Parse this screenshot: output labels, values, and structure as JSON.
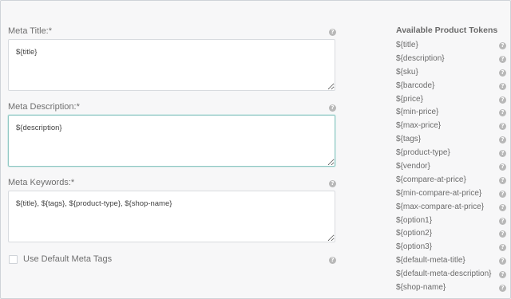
{
  "form": {
    "meta_title": {
      "label": "Meta Title:*",
      "value": "${title}"
    },
    "meta_description": {
      "label": "Meta Description:*",
      "value": "${description}"
    },
    "meta_keywords": {
      "label": "Meta Keywords:*",
      "value": "${title}, ${tags}, ${product-type}, ${shop-name}"
    },
    "default_meta": {
      "label": "Use Default Meta Tags",
      "checked": false
    }
  },
  "tokens": {
    "title": "Available Product Tokens",
    "items": [
      "${title}",
      "${description}",
      "${sku}",
      "${barcode}",
      "${price}",
      "${min-price}",
      "${max-price}",
      "${tags}",
      "${product-type}",
      "${vendor}",
      "${compare-at-price}",
      "${min-compare-at-price}",
      "${max-compare-at-price}",
      "${option1}",
      "${option2}",
      "${option3}",
      "${default-meta-title}",
      "${default-meta-description}",
      "${shop-name}"
    ]
  },
  "icons": {
    "help": "help-circle-icon",
    "help_glyph": "?"
  },
  "colors": {
    "focus_border": "#8fc7c3",
    "help_icon": "#b8b8b8"
  }
}
